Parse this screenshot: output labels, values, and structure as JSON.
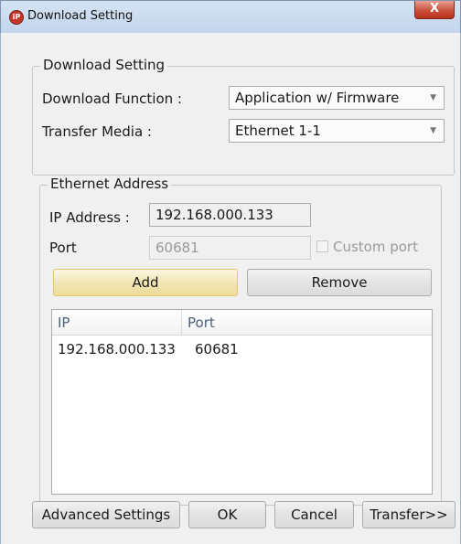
{
  "window": {
    "title": "Download Setting",
    "close_glyph": "X",
    "icon": "app-logo-icon"
  },
  "download_setting": {
    "legend": "Download Setting",
    "function_label": "Download Function :",
    "function_value": "Application w/ Firmware",
    "media_label": "Transfer Media :",
    "media_value": "Ethernet 1-1"
  },
  "ethernet": {
    "legend": "Ethernet Address",
    "ip_label": "IP Address :",
    "ip_value": "192.168.000.133",
    "port_label": "Port",
    "port_value": "60681",
    "custom_port_label": "Custom port",
    "custom_port_checked": false,
    "add_label": "Add",
    "remove_label": "Remove",
    "list": {
      "columns": [
        "IP",
        "Port"
      ],
      "rows": [
        {
          "ip": "192.168.000.133",
          "port": "60681"
        }
      ]
    }
  },
  "footer": {
    "advanced_label": "Advanced Settings",
    "ok_label": "OK",
    "cancel_label": "Cancel",
    "transfer_label": "Transfer>>"
  }
}
